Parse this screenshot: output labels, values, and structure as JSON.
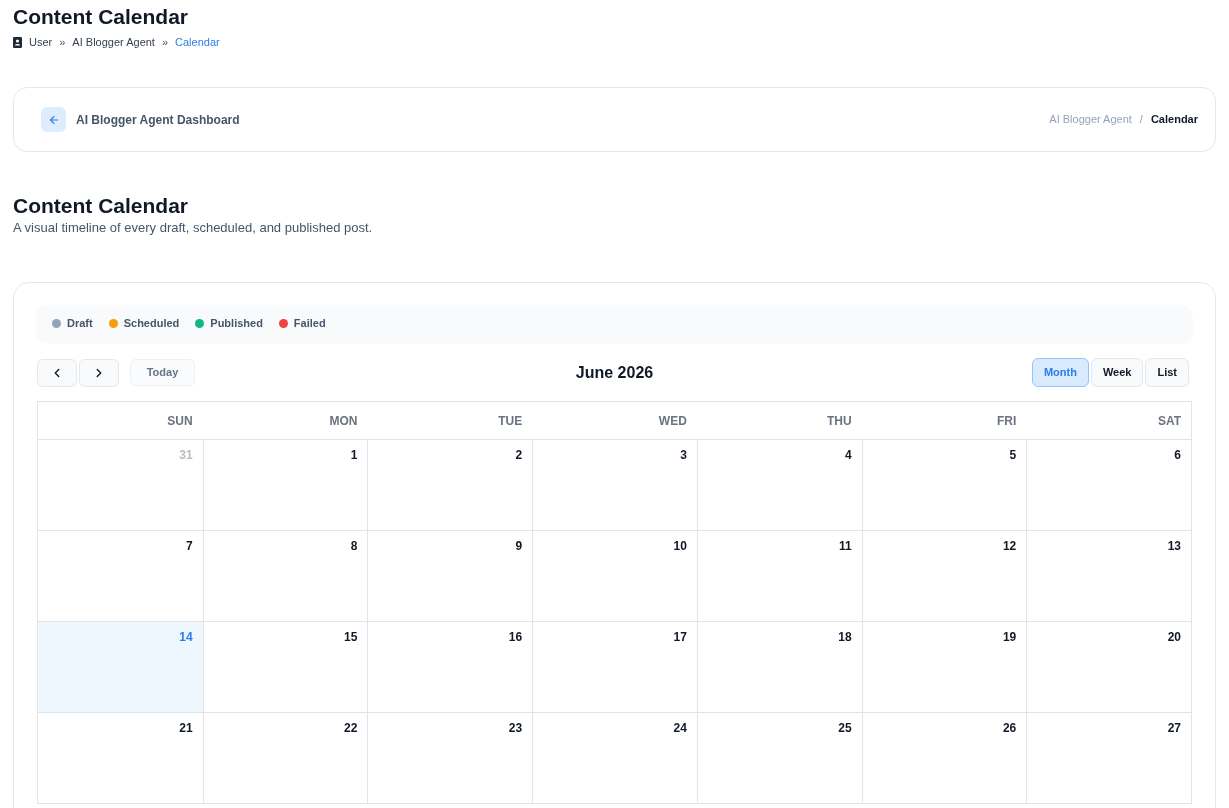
{
  "page_title": "Content Calendar",
  "breadcrumb": {
    "items": [
      {
        "label": "User",
        "current": false
      },
      {
        "label": "AI Blogger Agent",
        "current": false
      },
      {
        "label": "Calendar",
        "current": true
      }
    ],
    "separators": [
      "»",
      "»"
    ]
  },
  "header_card": {
    "back_label": "AI Blogger Agent Dashboard",
    "trail": {
      "items": [
        {
          "label": "AI Blogger Agent",
          "current": false
        },
        {
          "label": "Calendar",
          "current": true
        }
      ],
      "separators": [
        "/"
      ]
    }
  },
  "section": {
    "title": "Content Calendar",
    "subtitle": "A visual timeline of every draft, scheduled, and published post."
  },
  "calendar": {
    "legend": [
      {
        "label": "Draft",
        "color": "#94a3b8"
      },
      {
        "label": "Scheduled",
        "color": "#f59e0b"
      },
      {
        "label": "Published",
        "color": "#10b981"
      },
      {
        "label": "Failed",
        "color": "#ef4444"
      }
    ],
    "today_button": {
      "label": "Today",
      "disabled": true
    },
    "title": "June 2026",
    "views": [
      {
        "label": "Month",
        "selected": true
      },
      {
        "label": "Week",
        "selected": false
      },
      {
        "label": "List",
        "selected": false
      }
    ],
    "weekdays": [
      "SUN",
      "MON",
      "TUE",
      "WED",
      "THU",
      "FRI",
      "SAT"
    ],
    "weeks": [
      {
        "days": [
          {
            "day": "31",
            "in_month": false,
            "today": false
          },
          {
            "day": "1",
            "in_month": true,
            "today": false
          },
          {
            "day": "2",
            "in_month": true,
            "today": false
          },
          {
            "day": "3",
            "in_month": true,
            "today": false
          },
          {
            "day": "4",
            "in_month": true,
            "today": false
          },
          {
            "day": "5",
            "in_month": true,
            "today": false
          },
          {
            "day": "6",
            "in_month": true,
            "today": false
          }
        ]
      },
      {
        "days": [
          {
            "day": "7",
            "in_month": true,
            "today": false
          },
          {
            "day": "8",
            "in_month": true,
            "today": false
          },
          {
            "day": "9",
            "in_month": true,
            "today": false
          },
          {
            "day": "10",
            "in_month": true,
            "today": false
          },
          {
            "day": "11",
            "in_month": true,
            "today": false
          },
          {
            "day": "12",
            "in_month": true,
            "today": false
          },
          {
            "day": "13",
            "in_month": true,
            "today": false
          }
        ]
      },
      {
        "days": [
          {
            "day": "14",
            "in_month": true,
            "today": true
          },
          {
            "day": "15",
            "in_month": true,
            "today": false
          },
          {
            "day": "16",
            "in_month": true,
            "today": false
          },
          {
            "day": "17",
            "in_month": true,
            "today": false
          },
          {
            "day": "18",
            "in_month": true,
            "today": false
          },
          {
            "day": "19",
            "in_month": true,
            "today": false
          },
          {
            "day": "20",
            "in_month": true,
            "today": false
          }
        ]
      },
      {
        "days": [
          {
            "day": "21",
            "in_month": true,
            "today": false
          },
          {
            "day": "22",
            "in_month": true,
            "today": false
          },
          {
            "day": "23",
            "in_month": true,
            "today": false
          },
          {
            "day": "24",
            "in_month": true,
            "today": false
          },
          {
            "day": "25",
            "in_month": true,
            "today": false
          },
          {
            "day": "26",
            "in_month": true,
            "today": false
          },
          {
            "day": "27",
            "in_month": true,
            "today": false
          }
        ]
      }
    ]
  }
}
